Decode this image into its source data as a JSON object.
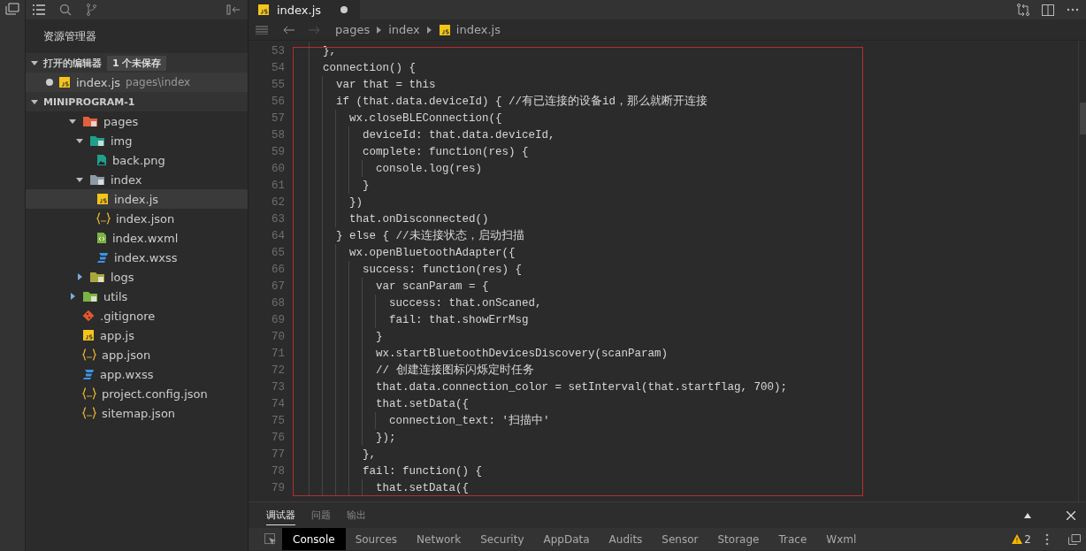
{
  "sidebar": {
    "title": "资源管理器",
    "open_editors": {
      "label": "打开的编辑器",
      "badge": "1 个未保存",
      "expanded": true,
      "items": [
        {
          "name": "index.js",
          "path": "pages\\index",
          "kind": "js",
          "modified": true,
          "selected": true
        }
      ]
    },
    "project": {
      "label": "MINIPROGRAM-1",
      "expanded": true,
      "items": [
        {
          "name": "pages",
          "kind": "folder",
          "color": "#e0603c",
          "expanded": true,
          "selected": false,
          "children": [
            {
              "name": "img",
              "kind": "folder",
              "color": "#1fa08a",
              "expanded": true,
              "selected": false,
              "children": [
                {
                  "name": "back.png",
                  "kind": "png",
                  "selected": false
                }
              ]
            },
            {
              "name": "index",
              "kind": "folder",
              "color": "#8a9aa6",
              "expanded": true,
              "selected": false,
              "children": [
                {
                  "name": "index.js",
                  "kind": "js",
                  "selected": true
                },
                {
                  "name": "index.json",
                  "kind": "json",
                  "selected": false
                },
                {
                  "name": "index.wxml",
                  "kind": "wxml",
                  "selected": false
                },
                {
                  "name": "index.wxss",
                  "kind": "wxss",
                  "selected": false
                }
              ]
            },
            {
              "name": "logs",
              "kind": "folder",
              "color": "#a8a83a",
              "expanded": false,
              "selected": false
            }
          ]
        },
        {
          "name": "utils",
          "kind": "folder",
          "color": "#7cb342",
          "expanded": false,
          "selected": false
        },
        {
          "name": ".gitignore",
          "kind": "git",
          "selected": false
        },
        {
          "name": "app.js",
          "kind": "js",
          "selected": false
        },
        {
          "name": "app.json",
          "kind": "json",
          "selected": false
        },
        {
          "name": "app.wxss",
          "kind": "wxss",
          "selected": false
        },
        {
          "name": "project.config.json",
          "kind": "json",
          "selected": false
        },
        {
          "name": "sitemap.json",
          "kind": "json",
          "selected": false
        }
      ]
    }
  },
  "editor": {
    "tab": {
      "name": "index.js",
      "kind": "js",
      "modified": true
    },
    "breadcrumb": [
      {
        "label": "pages",
        "kind": "folder"
      },
      {
        "label": "index",
        "kind": "folder"
      },
      {
        "label": "index.js",
        "kind": "js"
      }
    ],
    "lines": [
      {
        "number": "53",
        "text": "    },"
      },
      {
        "number": "54",
        "text": "    connection() {"
      },
      {
        "number": "55",
        "text": "      var that = this"
      },
      {
        "number": "56",
        "text": "      if (that.data.deviceId) { //有已连接的设备id，那么就断开连接"
      },
      {
        "number": "57",
        "text": "        wx.closeBLEConnection({"
      },
      {
        "number": "58",
        "text": "          deviceId: that.data.deviceId,"
      },
      {
        "number": "59",
        "text": "          complete: function(res) {"
      },
      {
        "number": "60",
        "text": "            console.log(res)"
      },
      {
        "number": "61",
        "text": "          }"
      },
      {
        "number": "62",
        "text": "        })"
      },
      {
        "number": "63",
        "text": "        that.onDisconnected()"
      },
      {
        "number": "64",
        "text": "      } else { //未连接状态，启动扫描"
      },
      {
        "number": "65",
        "text": "        wx.openBluetoothAdapter({"
      },
      {
        "number": "66",
        "text": "          success: function(res) {"
      },
      {
        "number": "67",
        "text": "            var scanParam = {"
      },
      {
        "number": "68",
        "text": "              success: that.onScaned,"
      },
      {
        "number": "69",
        "text": "              fail: that.showErrMsg"
      },
      {
        "number": "70",
        "text": "            }"
      },
      {
        "number": "71",
        "text": "            wx.startBluetoothDevicesDiscovery(scanParam)"
      },
      {
        "number": "72",
        "text": "            // 创建连接图标闪烁定时任务"
      },
      {
        "number": "73",
        "text": "            that.data.connection_color = setInterval(that.startflag, 700);"
      },
      {
        "number": "74",
        "text": "            that.setData({"
      },
      {
        "number": "75",
        "text": "              connection_text: '扫描中'"
      },
      {
        "number": "76",
        "text": "            });"
      },
      {
        "number": "77",
        "text": "          },"
      },
      {
        "number": "78",
        "text": "          fail: function() {"
      },
      {
        "number": "79",
        "text": "            that.setData({"
      }
    ]
  },
  "panel": {
    "tabs": [
      {
        "label": "调试器",
        "selected": true
      },
      {
        "label": "问题",
        "selected": false
      },
      {
        "label": "输出",
        "selected": false
      }
    ],
    "devtools_tabs": [
      {
        "label": "Console",
        "selected": true
      },
      {
        "label": "Sources",
        "selected": false
      },
      {
        "label": "Network",
        "selected": false
      },
      {
        "label": "Security",
        "selected": false
      },
      {
        "label": "AppData",
        "selected": false
      },
      {
        "label": "Audits",
        "selected": false
      },
      {
        "label": "Sensor",
        "selected": false
      },
      {
        "label": "Storage",
        "selected": false
      },
      {
        "label": "Trace",
        "selected": false
      },
      {
        "label": "Wxml",
        "selected": false
      }
    ],
    "warnings": "2"
  }
}
